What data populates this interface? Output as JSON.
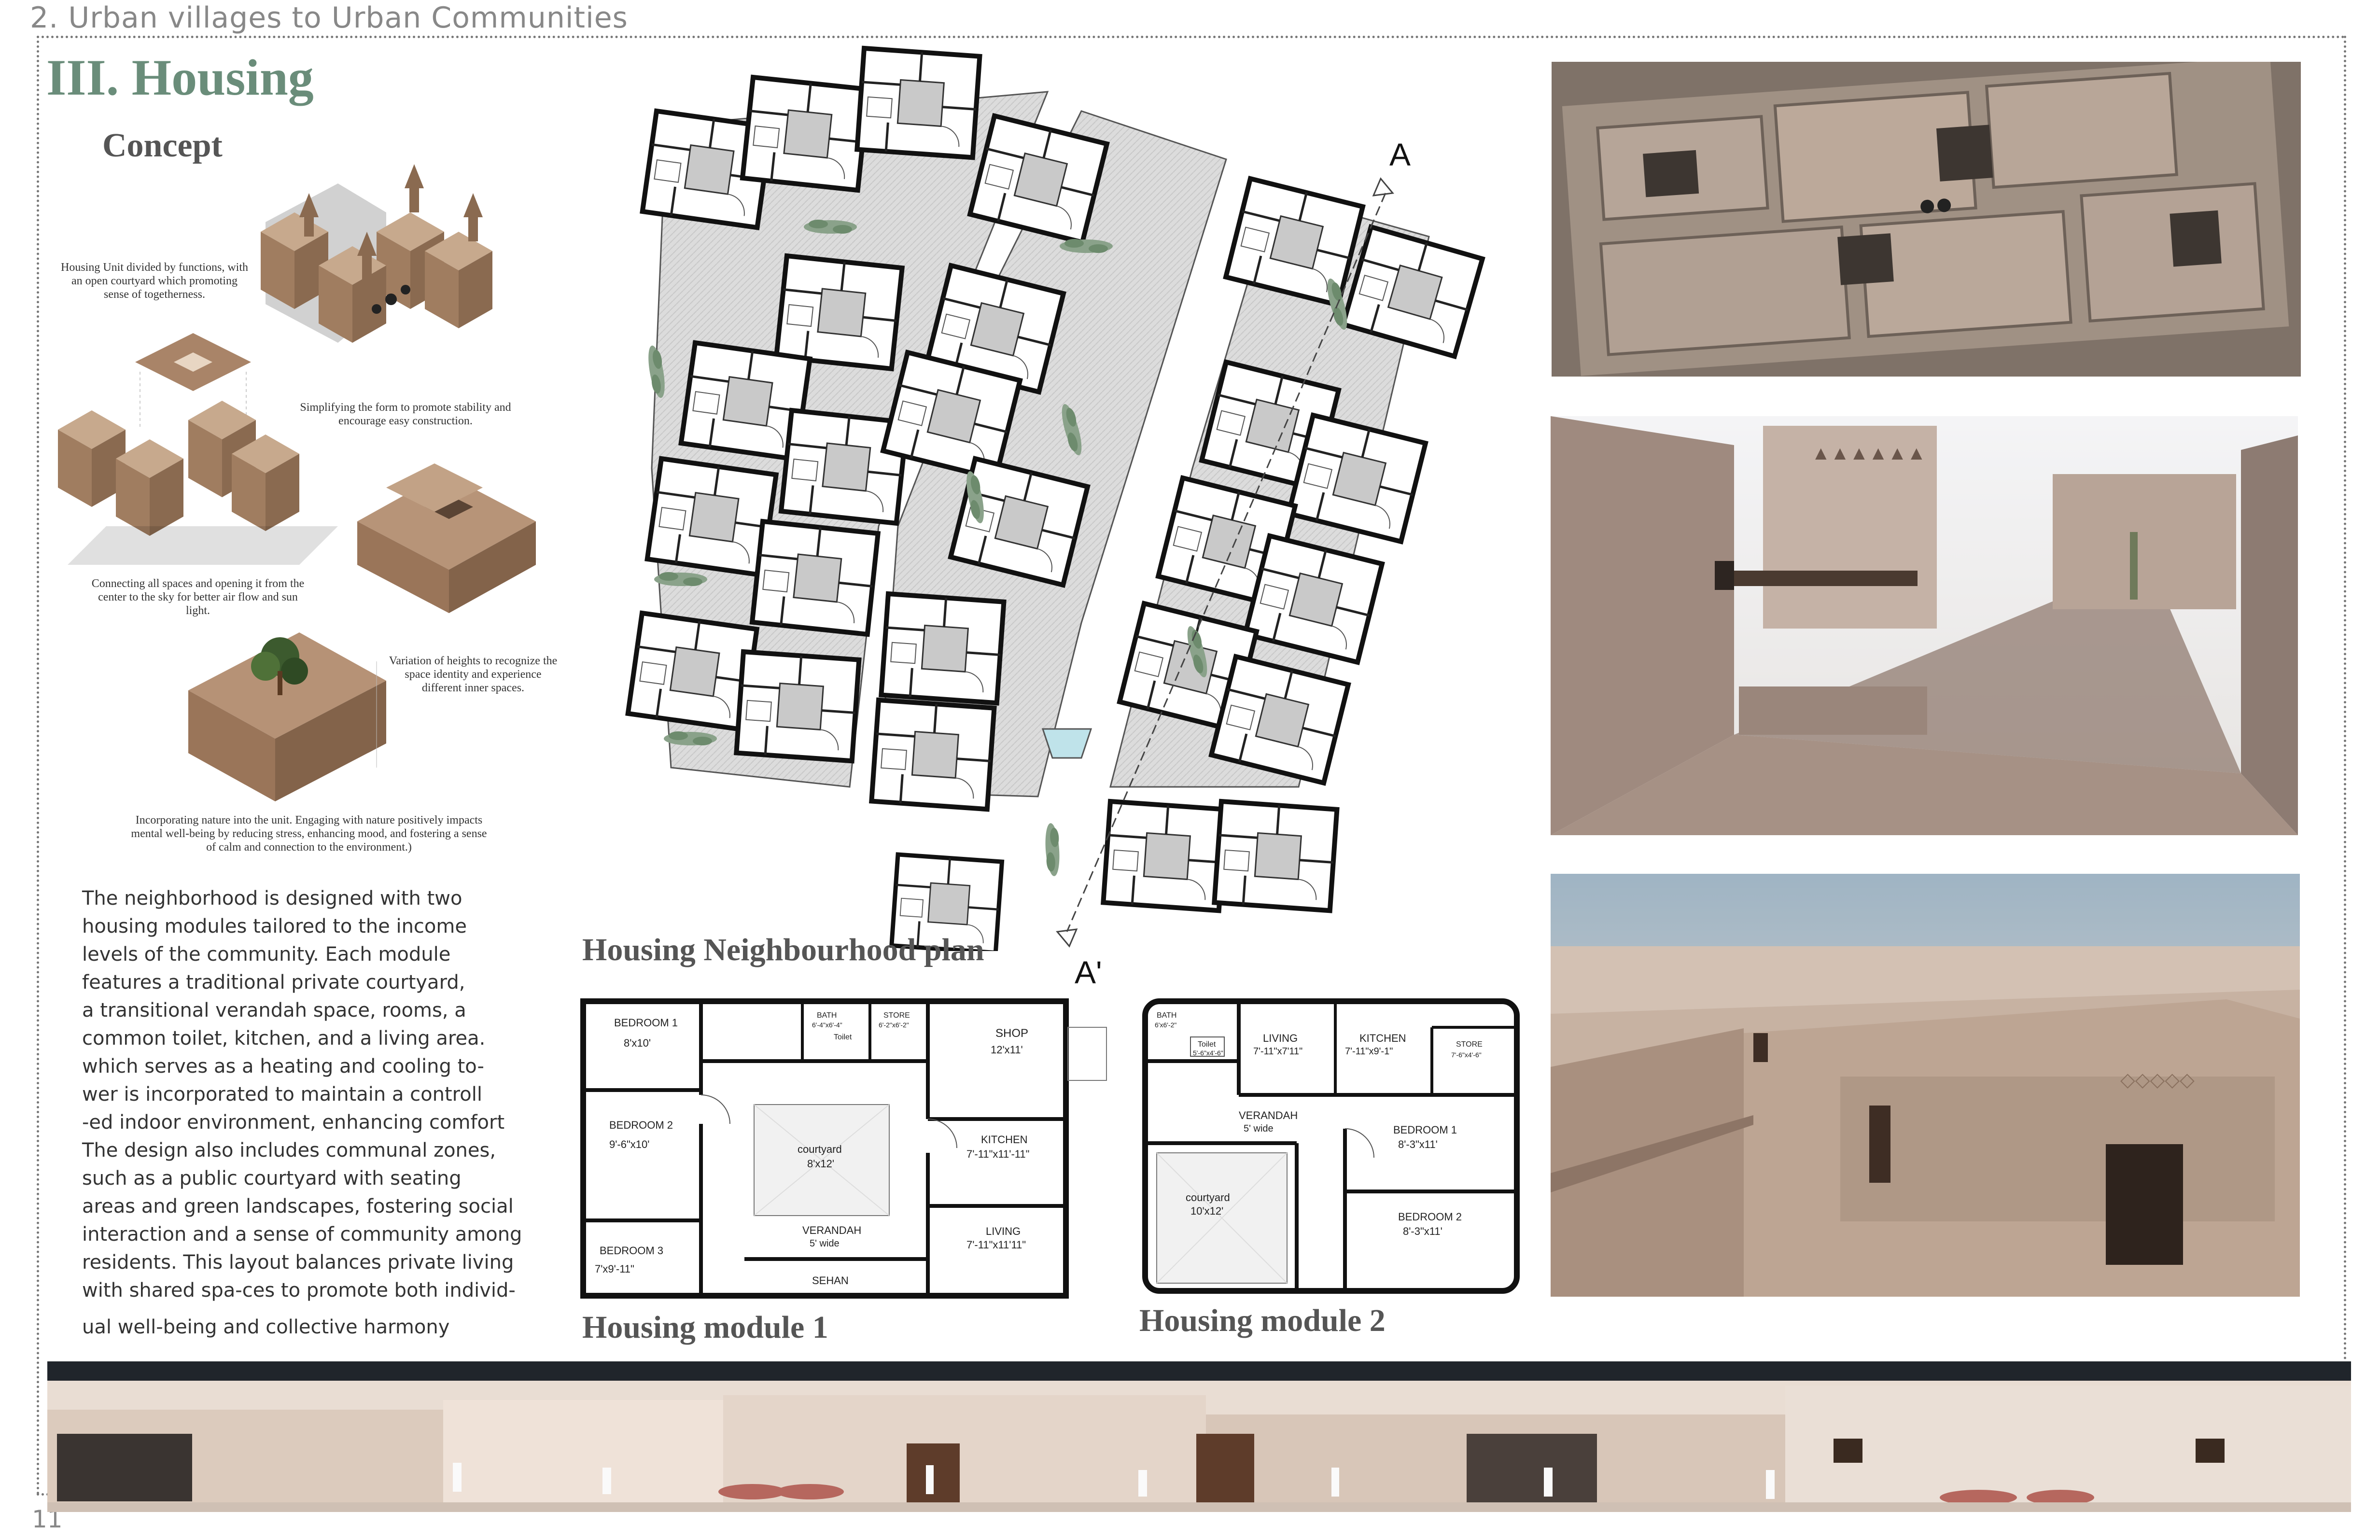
{
  "header": {
    "running_head": "2. Urban villages to Urban Communities",
    "page_number": "11"
  },
  "section": {
    "title": "III. Housing",
    "concept_title": "Concept"
  },
  "concept_captions": {
    "unit_divided": "Housing Unit divided by functions, with an open courtyard which promoting sense of togetherness.",
    "simplify": "Simplifying the form to promote stability and encourage easy construction.",
    "connecting": "Connecting all spaces and opening it from the center to the sky for better air flow and sun light.",
    "heights": "Variation of heights to recognize the space identity and experience different inner spaces.",
    "nature": "Incorporating nature into the unit. Engaging with nature positively impacts mental well-being by reducing stress, enhancing mood, and fostering a sense of calm and connection to the environment.)"
  },
  "description": {
    "lines": [
      "The neighborhood is designed with two",
      "housing modules tailored to the income",
      "levels of the community. Each module",
      "features a traditional private courtyard,",
      "a transitional verandah space, rooms, a",
      "common toilet, kitchen, and a living area.",
      "which serves as a  heating and cooling to-",
      "wer is incorporated to maintain a controll",
      "-ed indoor environment, enhancing comfort",
      "The design also includes communal zones,",
      "such as a public courtyard with seating",
      "areas and green landscapes, fostering social",
      "interaction and a sense of community among",
      "residents. This layout balances private living",
      "with shared spa-ces to promote both individ-",
      "ual  well-being  and  collective  harmony"
    ]
  },
  "plan": {
    "title": "Housing Neighbourhood plan",
    "section_start": "A",
    "section_end": "A'"
  },
  "module1": {
    "title": "Housing module 1",
    "rooms": [
      {
        "name": "BEDROOM 1",
        "dim": "8'x10'"
      },
      {
        "name": "BEDROOM 2",
        "dim": "9'-6\"x10'"
      },
      {
        "name": "BEDROOM 3",
        "dim": "7'x9'-11\""
      },
      {
        "name": "BATH",
        "dim": "6'-4\"x6'-4\""
      },
      {
        "name": "Toilet",
        "dim": ""
      },
      {
        "name": "STORE",
        "dim": "6'-2\"x6'-2\""
      },
      {
        "name": "SHOP",
        "dim": "12'x11'"
      },
      {
        "name": "courtyard",
        "dim": "8'x12'"
      },
      {
        "name": "KITCHEN",
        "dim": "7'-11\"x11'-11\""
      },
      {
        "name": "VERANDAH",
        "dim": "5' wide"
      },
      {
        "name": "LIVING",
        "dim": "7'-11\"x11'11\""
      },
      {
        "name": "SEHAN",
        "dim": ""
      }
    ]
  },
  "module2": {
    "title": "Housing module 2",
    "rooms": [
      {
        "name": "BATH",
        "dim": "6'x6'-2\""
      },
      {
        "name": "Toilet",
        "dim": "5'-6\"x4'-6\""
      },
      {
        "name": "LIVING",
        "dim": "7'-11\"x7'11\""
      },
      {
        "name": "KITCHEN",
        "dim": "7'-11\"x9'-1\""
      },
      {
        "name": "STORE",
        "dim": "7'-6\"x4'-6\""
      },
      {
        "name": "VERANDAH",
        "dim": "5' wide"
      },
      {
        "name": "BEDROOM 1",
        "dim": "8'-3\"x11'"
      },
      {
        "name": "courtyard",
        "dim": "10'x12'"
      },
      {
        "name": "BEDROOM 2",
        "dim": "8'-3\"x11'"
      }
    ]
  },
  "colors": {
    "title_green": "#6a8d7a",
    "mud": "#b08e72",
    "sand": "#c9b4a1",
    "sky": "#23262b",
    "paving": "#d8d8d8"
  }
}
